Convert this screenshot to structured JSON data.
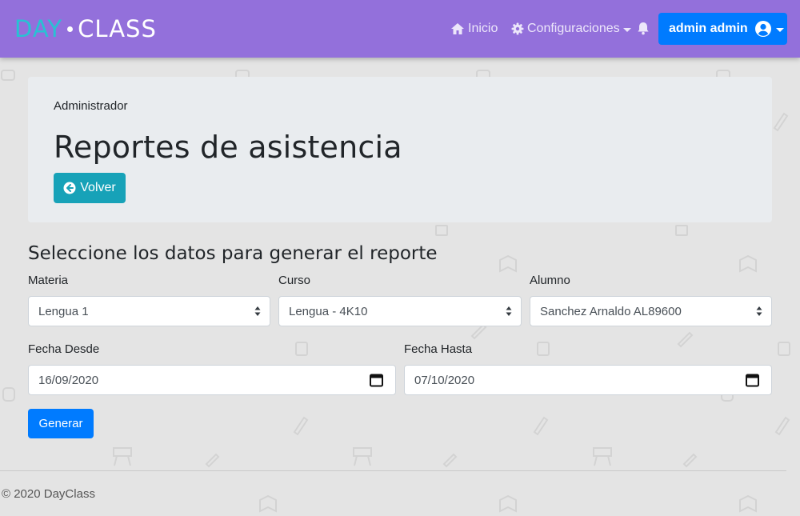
{
  "brand": {
    "part1": "DAY",
    "part2": "CLASS",
    "icon": "brand-dot"
  },
  "nav": {
    "inicio": {
      "label": "Inicio",
      "icon": "home-icon"
    },
    "config": {
      "label": "Configuraciones",
      "icon": "gear-icon"
    },
    "notifications": {
      "icon": "bell-icon"
    },
    "user": {
      "label": "admin admin",
      "icon": "user-circle-icon"
    }
  },
  "jumbotron": {
    "role": "Administrador",
    "title": "Reportes de asistencia",
    "back_button": "Volver"
  },
  "form": {
    "heading": "Seleccione los datos para generar el reporte",
    "materia": {
      "label": "Materia",
      "value": "Lengua 1"
    },
    "curso": {
      "label": "Curso",
      "value": "Lengua - 4K10"
    },
    "alumno": {
      "label": "Alumno",
      "value": "Sanchez Arnaldo AL89600"
    },
    "fecha_desde": {
      "label": "Fecha Desde",
      "value": "16/09/2020"
    },
    "fecha_hasta": {
      "label": "Fecha Hasta",
      "value": "07/10/2020"
    },
    "submit": "Generar"
  },
  "footer": {
    "text": "© 2020 DayClass"
  },
  "colors": {
    "navbar": "#9370db",
    "primary": "#007bff",
    "info": "#17a2b8",
    "brand_accent": "#27c2d3"
  }
}
